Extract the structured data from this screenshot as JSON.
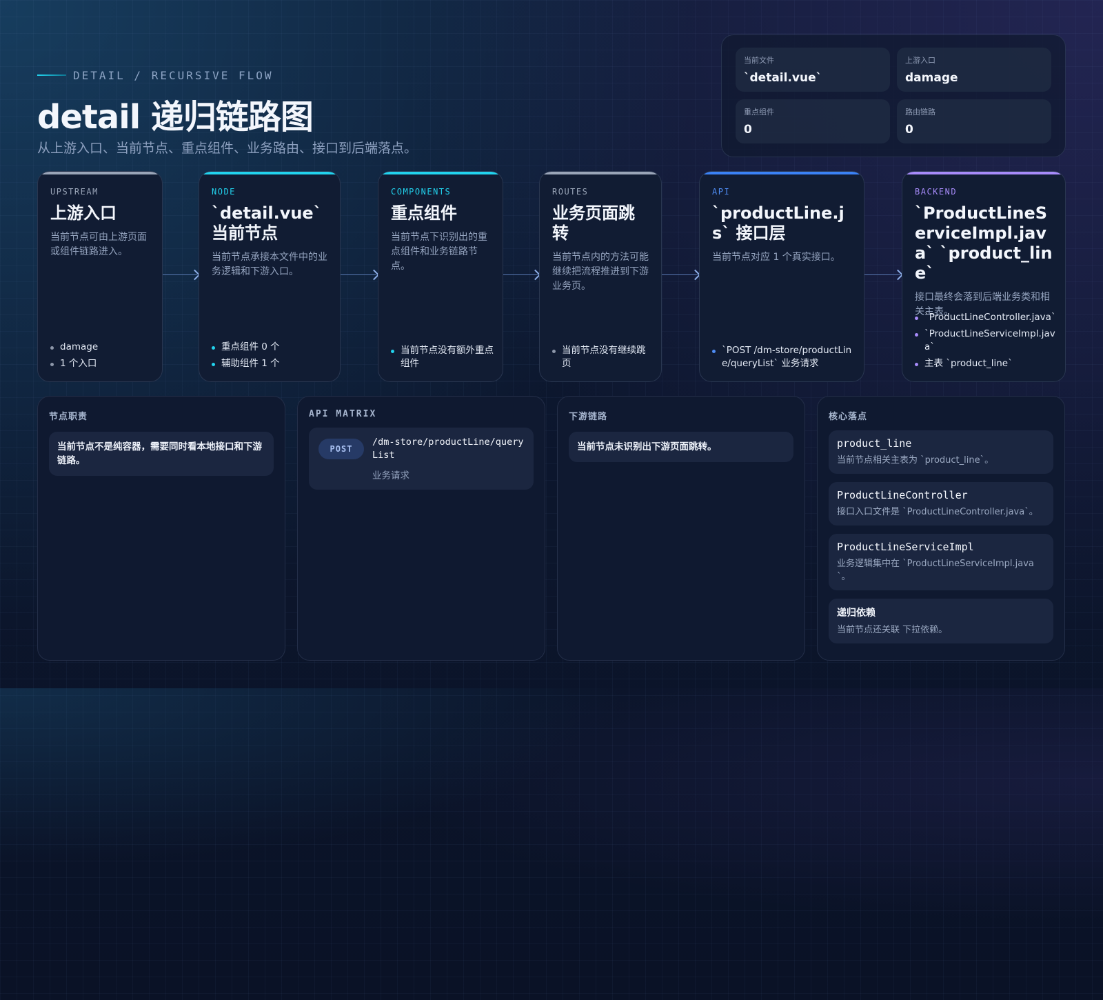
{
  "header": {
    "eyebrow": "DETAIL / RECURSIVE FLOW",
    "title": "detail 递归链路图",
    "subtitle": "从上游入口、当前节点、重点组件、业务路由、接口到后端落点。"
  },
  "stats": [
    {
      "label": "当前文件",
      "value": "`detail.vue`"
    },
    {
      "label": "上游入口",
      "value": "damage"
    },
    {
      "label": "重点组件",
      "value": "0"
    },
    {
      "label": "路由链路",
      "value": "0"
    }
  ],
  "flow": {
    "upstream": {
      "tag": "UPSTREAM",
      "title": "上游入口",
      "desc": "当前节点可由上游页面或组件链路进入。",
      "items": [
        "damage",
        "1 个入口"
      ]
    },
    "node": {
      "tag": "NODE",
      "title": "`detail.vue` 当前节点",
      "desc": "当前节点承接本文件中的业务逻辑和下游入口。",
      "items": [
        "重点组件 0 个",
        "辅助组件 1 个"
      ]
    },
    "components": {
      "tag": "COMPONENTS",
      "title": "重点组件",
      "desc": "当前节点下识别出的重点组件和业务链路节点。",
      "items": [
        "当前节点没有额外重点组件"
      ]
    },
    "routes": {
      "tag": "ROUTES",
      "title": "业务页面跳转",
      "desc": "当前节点内的方法可能继续把流程推进到下游业务页。",
      "items": [
        "当前节点没有继续跳页"
      ]
    },
    "api": {
      "tag": "API",
      "title": "`productLine.js` 接口层",
      "desc": "当前节点对应 1 个真实接口。",
      "items": [
        "`POST /dm-store/productLine/queryList` 业务请求"
      ]
    },
    "backend": {
      "tag": "BACKEND",
      "title": "`ProductLineServiceImpl.java` `product_line`",
      "desc": "接口最终会落到后端业务类和相关主表。",
      "items": [
        "`ProductLineController.java`",
        "`ProductLineServiceImpl.java`",
        "主表 `product_line`"
      ]
    }
  },
  "panels": {
    "duty": {
      "title": "节点职责",
      "note": "当前节点不是纯容器，需要同时看本地接口和下游链路。"
    },
    "api_matrix": {
      "title": "API MATRIX",
      "method": "POST",
      "path": "/dm-store/productLine/queryList",
      "desc": "业务请求"
    },
    "downstream": {
      "title": "下游链路",
      "note": "当前节点未识别出下游页面跳转。"
    },
    "core": {
      "title": "核心落点",
      "items": [
        {
          "name": "product_line",
          "desc": "当前节点相关主表为 `product_line`。"
        },
        {
          "name": "ProductLineController",
          "desc": "接口入口文件是 `ProductLineController.java`。"
        },
        {
          "name": "ProductLineServiceImpl",
          "desc": "业务逻辑集中在 `ProductLineServiceImpl.java`。"
        },
        {
          "name": "递归依赖",
          "desc": "当前节点还关联 下拉依赖。"
        }
      ]
    }
  },
  "colors": {
    "upstream": "#9aa5b8",
    "node": "#22d3ee",
    "components": "#22d3ee",
    "routes": "#9aa5b8",
    "api": "#3b82f6",
    "backend": "#a78bfa"
  }
}
